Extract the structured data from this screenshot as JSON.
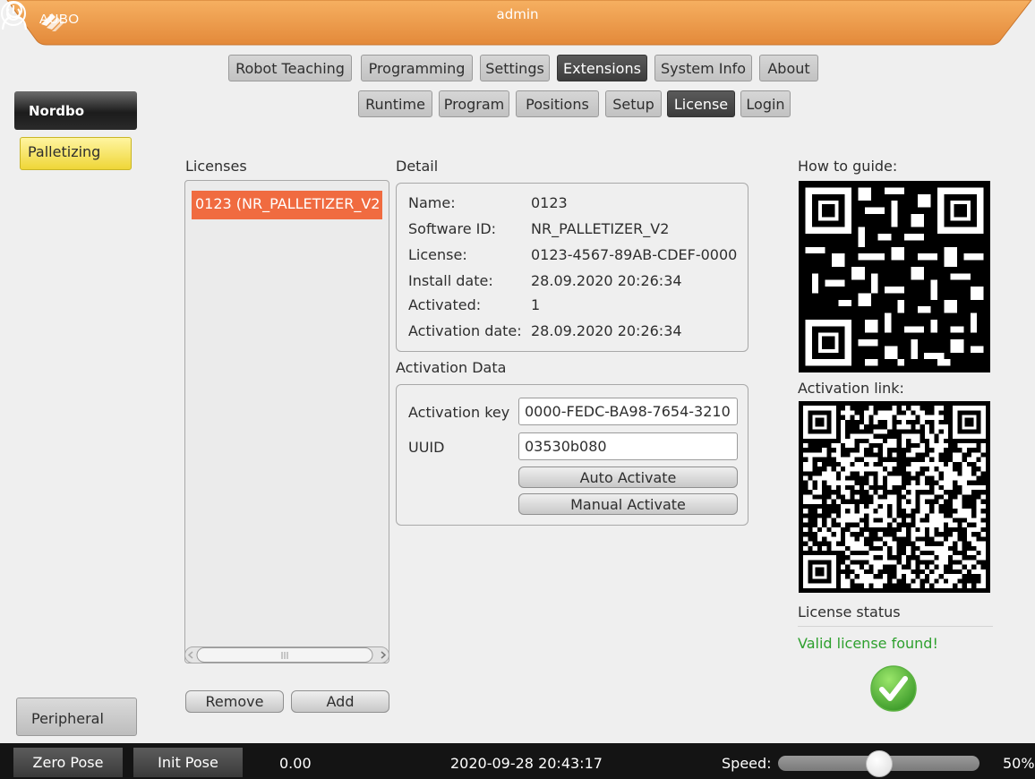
{
  "header": {
    "logo_text": "AUBO",
    "title": "admin",
    "bar_color": "#ef9a48"
  },
  "main_tabs": [
    {
      "label": "Robot Teaching",
      "active": false
    },
    {
      "label": "Programming",
      "active": false
    },
    {
      "label": "Settings",
      "active": false
    },
    {
      "label": "Extensions",
      "active": true
    },
    {
      "label": "System Info",
      "active": false
    },
    {
      "label": "About",
      "active": false
    }
  ],
  "sub_tabs": [
    {
      "label": "Runtime",
      "active": false
    },
    {
      "label": "Program",
      "active": false
    },
    {
      "label": "Positions",
      "active": false
    },
    {
      "label": "Setup",
      "active": false
    },
    {
      "label": "License",
      "active": true
    },
    {
      "label": "Login",
      "active": false
    }
  ],
  "sidebar": {
    "nordbo": "Nordbo",
    "palletizing": "Palletizing",
    "peripheral": "Peripheral"
  },
  "licenses": {
    "title": "Licenses",
    "items": [
      "0123 (NR_PALLETIZER_V2"
    ],
    "remove_label": "Remove",
    "add_label": "Add"
  },
  "detail": {
    "title": "Detail",
    "rows": [
      {
        "key": "Name:",
        "value": "0123"
      },
      {
        "key": "Software ID:",
        "value": "NR_PALLETIZER_V2"
      },
      {
        "key": "License:",
        "value": "0123-4567-89AB-CDEF-0000"
      },
      {
        "key": "Install date:",
        "value": "28.09.2020 20:26:34"
      },
      {
        "key": "Activated:",
        "value": "1"
      },
      {
        "key": "Activation date:",
        "value": "28.09.2020 20:26:34"
      }
    ]
  },
  "activation": {
    "title": "Activation Data",
    "key_label": "Activation key",
    "key_value": "0000-FEDC-BA98-7654-3210",
    "uuid_label": "UUID",
    "uuid_value": "03530b080",
    "auto_label": "Auto Activate",
    "manual_label": "Manual Activate"
  },
  "right_panel": {
    "guide_label": "How to guide:",
    "link_label": "Activation link:",
    "status_title": "License status",
    "status_text": "Valid license found!",
    "status_color": "#2ea02e"
  },
  "statusbar": {
    "zero_pose": "Zero Pose",
    "init_pose": "Init Pose",
    "value": "0.00",
    "datetime": "2020-09-28 20:43:17",
    "speed_label": "Speed:",
    "speed_percent": "50%",
    "speed_fraction": 0.5
  }
}
